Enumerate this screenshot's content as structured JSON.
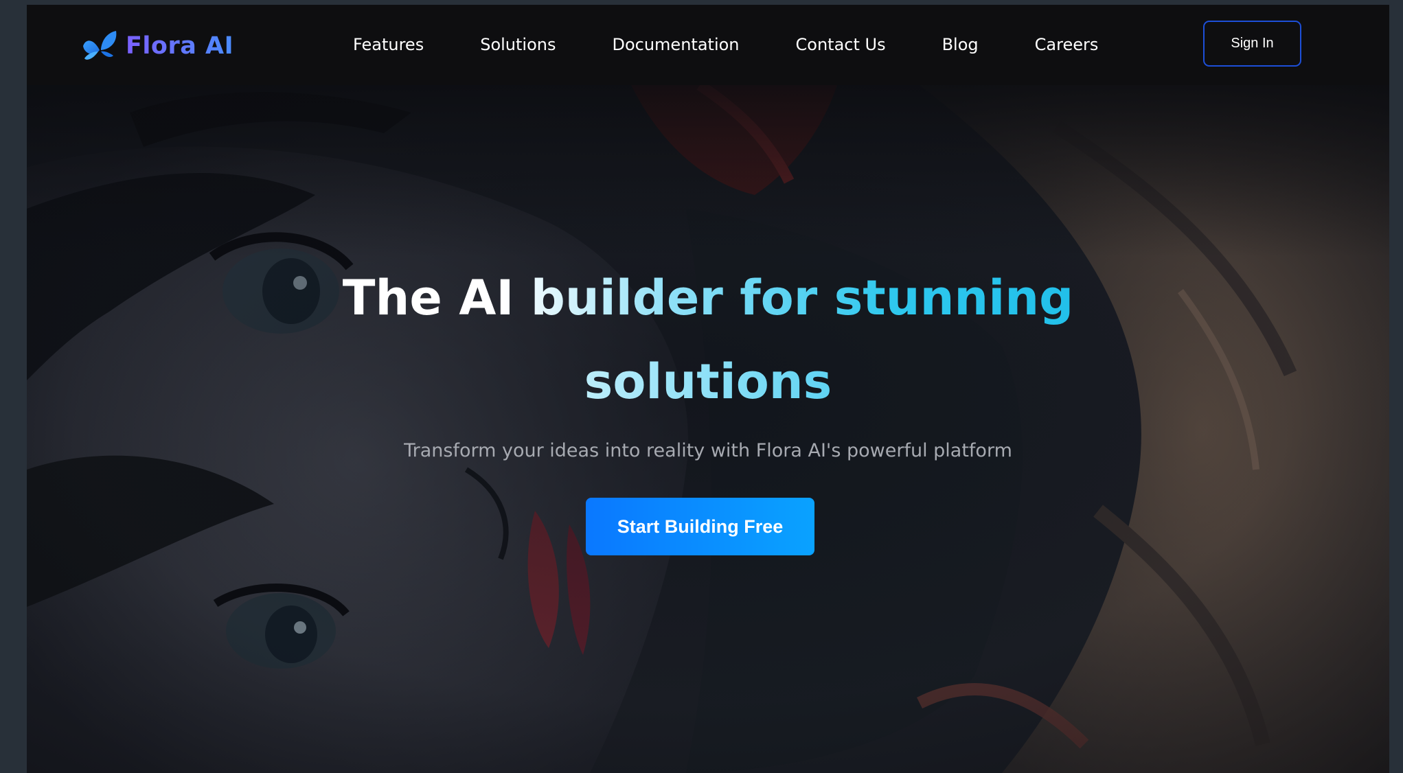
{
  "brand": {
    "name": "Flora AI",
    "logo_icon": "butterfly-icon",
    "gradient": [
      "#7b61ff",
      "#4a8cff"
    ]
  },
  "nav": {
    "links": [
      "Features",
      "Solutions",
      "Documentation",
      "Contact Us",
      "Blog",
      "Careers"
    ],
    "sign_in_label": "Sign In"
  },
  "hero": {
    "headline_line1": "The AI builder for stunning",
    "headline_line2": "solutions",
    "subtitle": "Transform your ideas into reality with Flora AI's powerful platform",
    "cta_label": "Start Building Free",
    "background": "anime-style illustration"
  },
  "colors": {
    "page_bg": "#283039",
    "nav_bg": "#0e0e10",
    "cta": "#0a8cff",
    "sign_in_border": "#1d4fd8",
    "headline_accent": "#22c0ea"
  }
}
